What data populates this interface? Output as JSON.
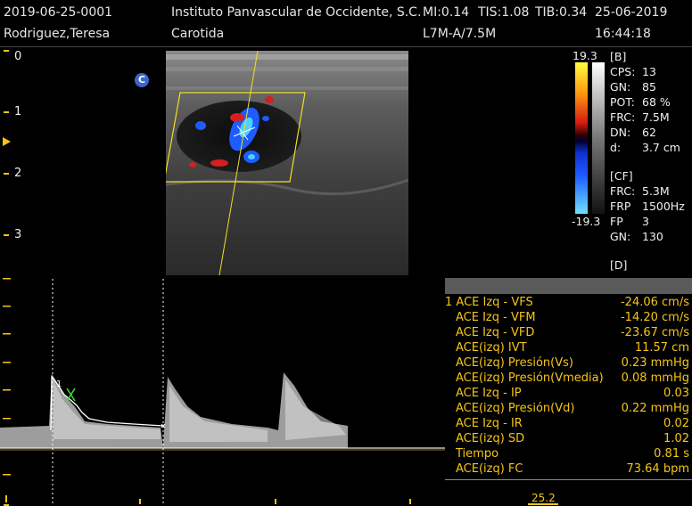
{
  "header": {
    "patient_id": "2019-06-25-0001",
    "institution": "Instituto Panvascular de Occidente, S.C.",
    "mi": "MI:0.14",
    "tis": "TIS:1.08",
    "tib": "TIB:0.34",
    "date": "25-06-2019",
    "patient_name": "Rodriguez,Teresa",
    "exam": "Carotida",
    "probe": "L7M-A/7.5M",
    "time": "16:44:18"
  },
  "depth_scale": [
    "0",
    "1",
    "2",
    "3"
  ],
  "region_marker": "C",
  "color_scale": {
    "top": "19.3",
    "bottom": "-19.3"
  },
  "params": {
    "b_title": "[B]",
    "b": [
      {
        "label": "CPS:",
        "value": "13"
      },
      {
        "label": "GN:",
        "value": "85"
      },
      {
        "label": "POT:",
        "value": "68 %"
      },
      {
        "label": "FRC:",
        "value": "7.5M"
      },
      {
        "label": "DN:",
        "value": "62"
      },
      {
        "label": "d:",
        "value": "3.7 cm"
      }
    ],
    "cf_title": "[CF]",
    "cf": [
      {
        "label": "FRC:",
        "value": "5.3M"
      },
      {
        "label": "FRP",
        "value": "1500Hz"
      },
      {
        "label": "FP",
        "value": "3"
      },
      {
        "label": "GN:",
        "value": "130"
      }
    ],
    "d_title": "[D]"
  },
  "measurements": [
    {
      "label": "1 ACE Izq - VFS",
      "value": "-24.06 cm/s"
    },
    {
      "label": "ACE Izq - VFM",
      "value": "-14.20 cm/s"
    },
    {
      "label": "ACE Izq - VFD",
      "value": "-23.67 cm/s"
    },
    {
      "label": "ACE(izq) IVT",
      "value": "11.57 cm"
    },
    {
      "label": "ACE(izq) Presión(Vs)",
      "value": "0.23 mmHg"
    },
    {
      "label": "ACE(izq) Presión(Vmedia)",
      "value": "0.08 mmHg"
    },
    {
      "label": "ACE Izq - IP",
      "value": "0.03"
    },
    {
      "label": "ACE(izq) Presión(Vd)",
      "value": "0.22 mmHg"
    },
    {
      "label": "ACE Izq - IR",
      "value": "0.02"
    },
    {
      "label": "ACE(izq) SD",
      "value": "1.02"
    },
    {
      "label": "Tiempo",
      "value": "0.81 s"
    },
    {
      "label": "ACE(izq) FC",
      "value": "73.64 bpm"
    }
  ],
  "spectral": {
    "bottom_readout": "25.2",
    "cursor_label": "1"
  },
  "colors": {
    "accent": "#f5c518",
    "cf_positive": "#d42020",
    "cf_negative": "#1e5cff"
  }
}
